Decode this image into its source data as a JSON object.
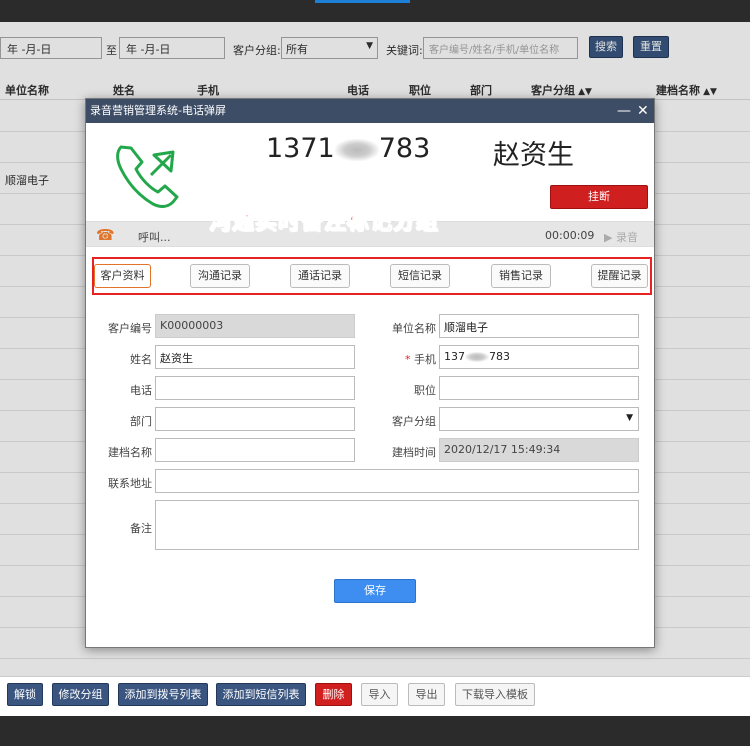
{
  "filters": {
    "date_start": "年 -月-日",
    "date_sep": "至",
    "date_end": "年 -月-日",
    "group_label": "客户分组:",
    "group_value": "所有",
    "keyword_label": "关键词:",
    "keyword_placeholder": "客户编号/姓名/手机/单位名称",
    "search_label": "搜索",
    "reset_label": "重置"
  },
  "table": {
    "columns": [
      "单位名称",
      "姓名",
      "手机",
      "电话",
      "职位",
      "部门",
      "客户分组",
      "建档名称"
    ],
    "rows": [
      "",
      "",
      "顺溜电子",
      "",
      "",
      "",
      "",
      "",
      "",
      "",
      "",
      "",
      "",
      "",
      "",
      "",
      "",
      "",
      ""
    ]
  },
  "bottom_toolbar": {
    "unlock": "解锁",
    "modify_group": "修改分组",
    "add_dial_list": "添加到拨号列表",
    "add_sms_list": "添加到短信列表",
    "delete": "删除",
    "import": "导入",
    "export": "导出",
    "download_template": "下载导入模板"
  },
  "dialog": {
    "title": "录音营销管理系统-电话弹屏",
    "phone_prefix": "1371",
    "phone_suffix": "783",
    "caller_name": "赵资生",
    "hangup_label": "挂断",
    "annotation": "沟通实时备注标记分组",
    "status": {
      "state_text": "呼叫...",
      "timer": "00:00:09",
      "record_label": "录音"
    },
    "tabs": [
      "客户资料",
      "沟通记录",
      "通话记录",
      "短信记录",
      "销售记录",
      "提醒记录"
    ],
    "form": {
      "customer_id_label": "客户编号",
      "customer_id": "K00000003",
      "company_label": "单位名称",
      "company": "顺溜电子",
      "name_label": "姓名",
      "name": "赵资生",
      "mobile_label": "手机",
      "mobile_prefix": "137",
      "mobile_suffix": "783",
      "phone_label": "电话",
      "position_label": "职位",
      "department_label": "部门",
      "group_label": "客户分组",
      "archive_name_label": "建档名称",
      "archive_time_label": "建档时间",
      "archive_time": "2020/12/17 15:49:34",
      "address_label": "联系地址",
      "remark_label": "备注",
      "save_label": "保存"
    }
  },
  "colors": {
    "title_bar": "#3d4d66",
    "danger": "#d01f1f",
    "primary": "#3d8ef0",
    "dark_button": "#3a5680",
    "annotation": "#e82222"
  }
}
